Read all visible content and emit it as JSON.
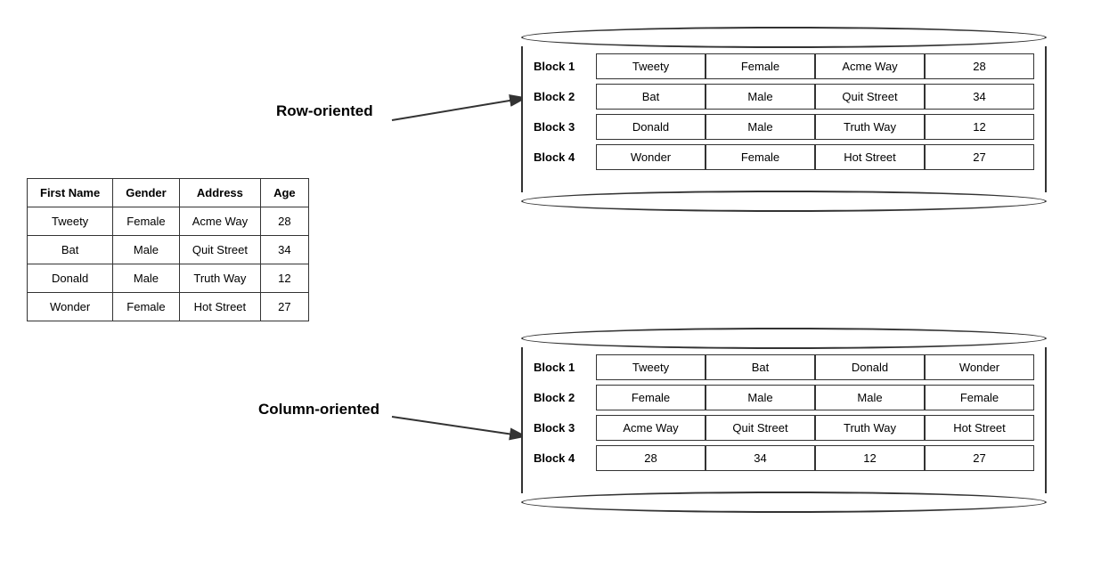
{
  "source_table": {
    "headers": [
      "First Name",
      "Gender",
      "Address",
      "Age"
    ],
    "rows": [
      [
        "Tweety",
        "Female",
        "Acme Way",
        "28"
      ],
      [
        "Bat",
        "Male",
        "Quit Street",
        "34"
      ],
      [
        "Donald",
        "Male",
        "Truth Way",
        "12"
      ],
      [
        "Wonder",
        "Female",
        "Hot Street",
        "27"
      ]
    ]
  },
  "row_oriented": {
    "label": "Row-oriented",
    "blocks": [
      {
        "label": "Block 1",
        "cells": [
          "Tweety",
          "Female",
          "Acme Way",
          "28"
        ]
      },
      {
        "label": "Block 2",
        "cells": [
          "Bat",
          "Male",
          "Quit Street",
          "34"
        ]
      },
      {
        "label": "Block 3",
        "cells": [
          "Donald",
          "Male",
          "Truth Way",
          "12"
        ]
      },
      {
        "label": "Block 4",
        "cells": [
          "Wonder",
          "Female",
          "Hot Street",
          "27"
        ]
      }
    ]
  },
  "column_oriented": {
    "label": "Column-oriented",
    "blocks": [
      {
        "label": "Block 1",
        "cells": [
          "Tweety",
          "Bat",
          "Donald",
          "Wonder"
        ]
      },
      {
        "label": "Block 2",
        "cells": [
          "Female",
          "Male",
          "Male",
          "Female"
        ]
      },
      {
        "label": "Block 3",
        "cells": [
          "Acme Way",
          "Quit Street",
          "Truth Way",
          "Hot Street"
        ]
      },
      {
        "label": "Block 4",
        "cells": [
          "28",
          "34",
          "12",
          "27"
        ]
      }
    ]
  }
}
